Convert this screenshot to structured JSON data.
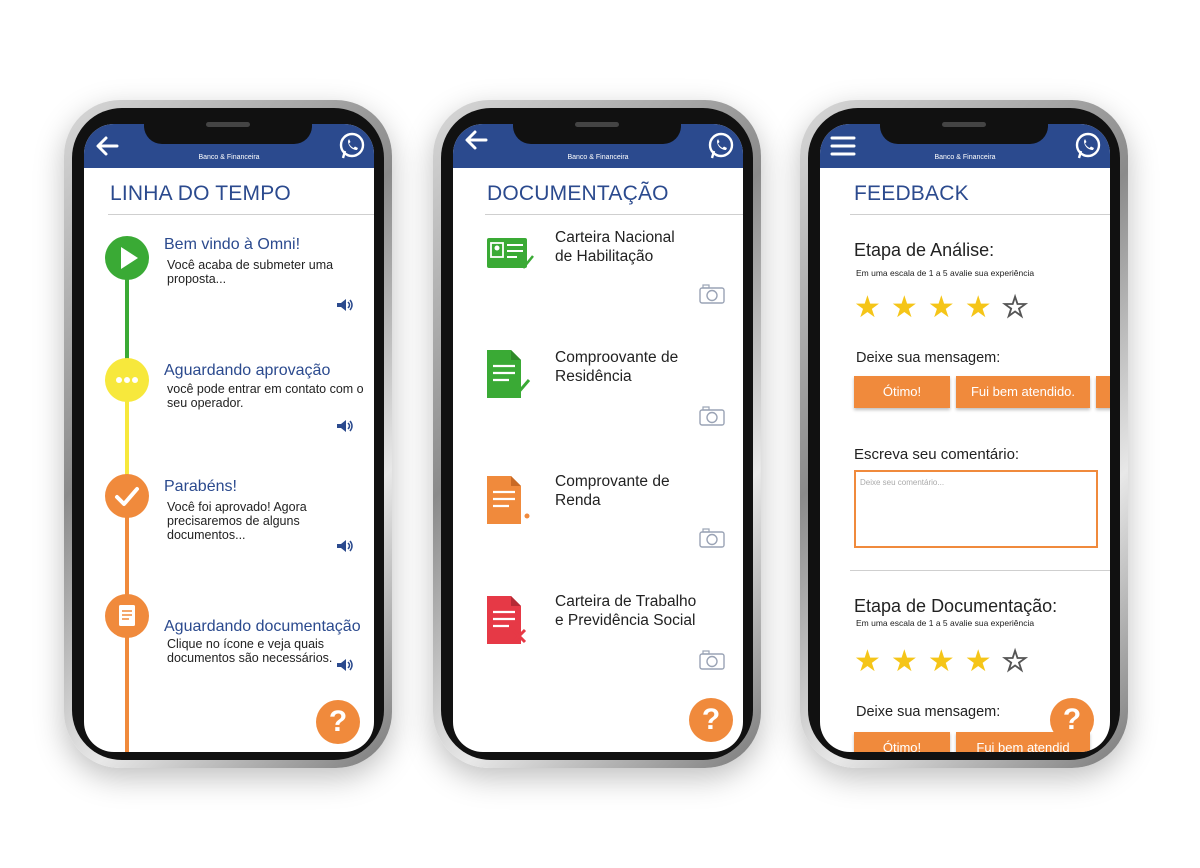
{
  "brand_text": "Banco & Financeira",
  "help_label": "?",
  "timeline": {
    "title": "LINHA DO TEMPO",
    "items": [
      {
        "title": "Bem vindo à Omni!",
        "desc": "Você acaba de submeter uma proposta..."
      },
      {
        "title": "Aguardando aprovação",
        "desc": "você pode entrar em contato com o seu operador."
      },
      {
        "title": "Parabéns!",
        "desc": "Você foi aprovado! Agora precisaremos de alguns documentos..."
      },
      {
        "title": "Aguardando documentação",
        "desc": "Clique no ícone e veja quais documentos são necessários."
      }
    ]
  },
  "documents": {
    "title": "DOCUMENTAÇÃO",
    "items": [
      {
        "line1": "Carteira Nacional",
        "line2": "de Habilitação"
      },
      {
        "line1": "Comproovante de",
        "line2": "Residência"
      },
      {
        "line1": "Comprovante de",
        "line2": "Renda"
      },
      {
        "line1": "Carteira de Trabalho",
        "line2": "e Previdência Social"
      }
    ]
  },
  "feedback": {
    "title": "FEEDBACK",
    "stage1_title": "Etapa de Análise:",
    "stage1_scale": "Em uma escala de 1 a 5 avalie sua experiência",
    "stage1_rating": 4,
    "message_label": "Deixe sua mensagem:",
    "option_otimo": "Ótimo!",
    "option_atendido": "Fui bem atendido.",
    "option_atendido_cut": "Fui bem atendid",
    "comment_label": "Escreva seu comentário:",
    "comment_placeholder": "Deixe seu comentário...",
    "stage2_title": "Etapa de Documentação:",
    "stage2_scale": "Em uma escala de 1 a 5 avalie sua experiência",
    "stage2_rating": 4,
    "message_label_2": "Deixe sua mensagem:"
  },
  "colors": {
    "header": "#2b4a8e",
    "green": "#3aaa35",
    "yellow": "#f7e83c",
    "orange": "#f08a3c",
    "red": "#e63946",
    "star": "#f5c518"
  }
}
